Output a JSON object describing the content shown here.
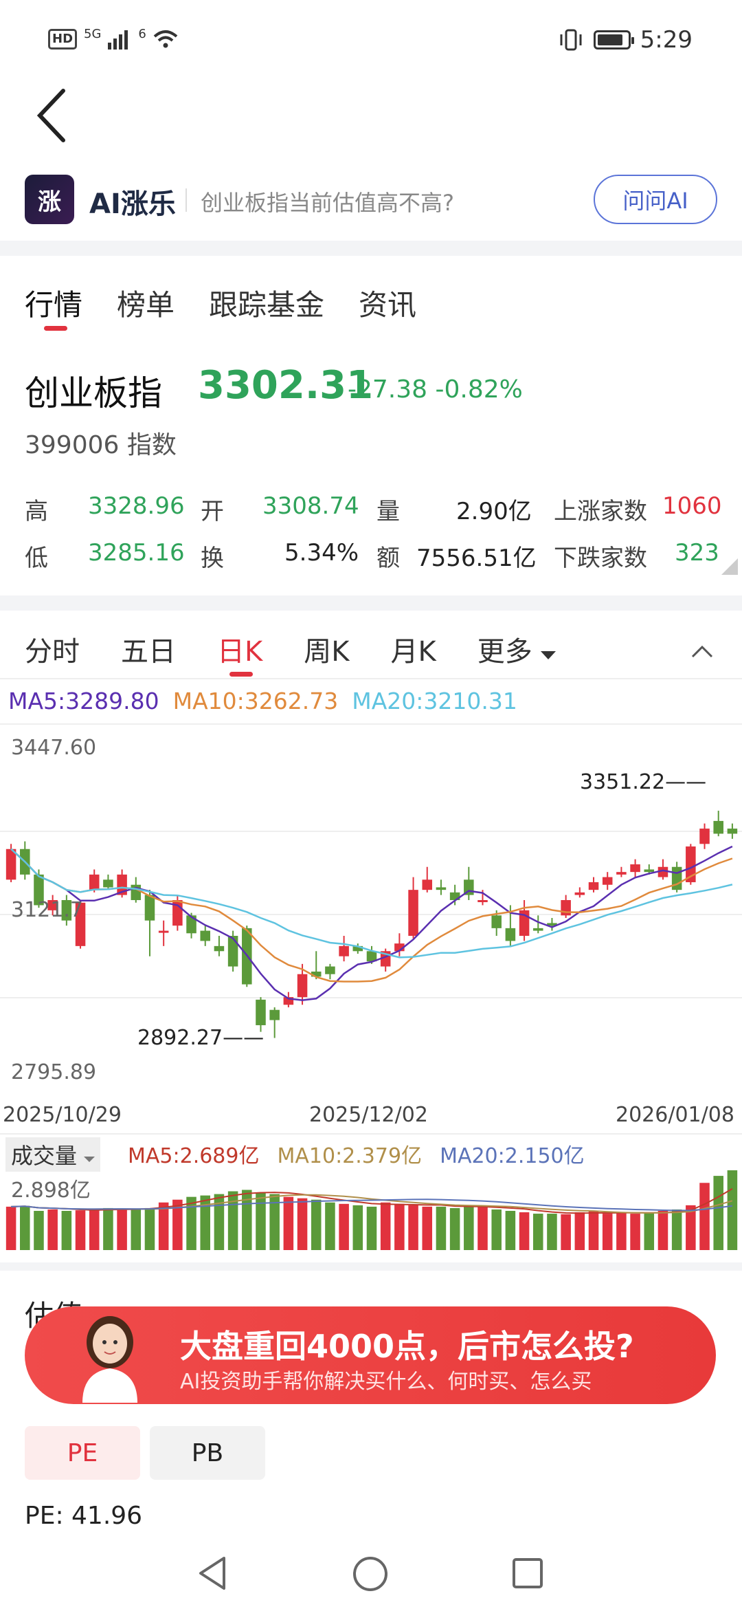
{
  "status_bar": {
    "hd": "HD",
    "signal": "5G",
    "wifi": "6",
    "time": "5:29"
  },
  "ai_bar": {
    "logo_text": "涨",
    "title": "AI涨乐",
    "question": "创业板指当前估值高不高?",
    "ask_button": "问问AI"
  },
  "top_tabs": [
    {
      "label": "行情"
    },
    {
      "label": "榜单"
    },
    {
      "label": "跟踪基金"
    },
    {
      "label": "资讯"
    }
  ],
  "quote": {
    "name": "创业板指",
    "price": "3302.31",
    "change": "-27.38",
    "change_pct": "-0.82%",
    "code_line": "399006 指数",
    "high_label": "高",
    "high": "3328.96",
    "open_label": "开",
    "open": "3308.74",
    "vol_label": "量",
    "vol": "2.90亿",
    "up_label": "上涨家数",
    "up": "1060",
    "low_label": "低",
    "low": "3285.16",
    "turn_label": "换",
    "turn": "5.34%",
    "amt_label": "额",
    "amt": "7556.51亿",
    "down_label": "下跌家数",
    "down": "323"
  },
  "chart_tabs": [
    {
      "label": "分时"
    },
    {
      "label": "五日"
    },
    {
      "label": "日K"
    },
    {
      "label": "周K"
    },
    {
      "label": "月K"
    },
    {
      "label": "更多"
    }
  ],
  "ma": {
    "ma5": "MA5:3289.80",
    "ma10": "MA10:3262.73",
    "ma20": "MA20:3210.31"
  },
  "axis": {
    "top": "3447.60",
    "mid": "3121.7",
    "bottom": "2795.89",
    "date_start": "2025/10/29",
    "date_mid": "2025/12/02",
    "date_end": "2026/01/08",
    "high_mark": "3351.22",
    "low_mark": "2892.27"
  },
  "volume": {
    "label": "成交量",
    "ma5": "MA5:2.689亿",
    "ma10": "MA10:2.379亿",
    "ma20": "MA20:2.150亿",
    "top": "2.898亿"
  },
  "banner": {
    "title": "大盘重回4000点，后市怎么投?",
    "subtitle": "AI投资助手帮你解决买什么、何时买、怎么买"
  },
  "valuation": {
    "section_title": "估值",
    "pe_tab": "PE",
    "pb_tab": "PB",
    "pe_value": "PE: 41.96"
  },
  "colors": {
    "up": "#e1323e",
    "down": "#5b9a3a",
    "ma5": "#5a2fb0",
    "ma10": "#e08a3c",
    "ma20": "#5ec3e0",
    "accent": "#e1323e"
  },
  "chart_data": {
    "type": "candlestick",
    "ylim": [
      2795.89,
      3447.6
    ],
    "candles": [
      {
        "o": 3190,
        "c": 3250,
        "h": 3260,
        "l": 3185
      },
      {
        "o": 3250,
        "c": 3200,
        "h": 3265,
        "l": 3190
      },
      {
        "o": 3200,
        "c": 3140,
        "h": 3210,
        "l": 3135
      },
      {
        "o": 3130,
        "c": 3150,
        "h": 3160,
        "l": 3120
      },
      {
        "o": 3150,
        "c": 3110,
        "h": 3160,
        "l": 3100
      },
      {
        "o": 3060,
        "c": 3145,
        "h": 3150,
        "l": 3055
      },
      {
        "o": 3170,
        "c": 3200,
        "h": 3210,
        "l": 3165
      },
      {
        "o": 3190,
        "c": 3175,
        "h": 3200,
        "l": 3170
      },
      {
        "o": 3160,
        "c": 3200,
        "h": 3210,
        "l": 3155
      },
      {
        "o": 3180,
        "c": 3150,
        "h": 3195,
        "l": 3145
      },
      {
        "o": 3160,
        "c": 3110,
        "h": 3170,
        "l": 3040
      },
      {
        "o": 3090,
        "c": 3090,
        "h": 3110,
        "l": 3060
      },
      {
        "o": 3100,
        "c": 3150,
        "h": 3160,
        "l": 3090
      },
      {
        "o": 3120,
        "c": 3085,
        "h": 3125,
        "l": 3075
      },
      {
        "o": 3090,
        "c": 3070,
        "h": 3100,
        "l": 3060
      },
      {
        "o": 3060,
        "c": 3050,
        "h": 3080,
        "l": 3040
      },
      {
        "o": 3080,
        "c": 3020,
        "h": 3090,
        "l": 3010
      },
      {
        "o": 3095,
        "c": 2985,
        "h": 3100,
        "l": 2980
      },
      {
        "o": 2955,
        "c": 2905,
        "h": 2960,
        "l": 2892
      },
      {
        "o": 2935,
        "c": 2915,
        "h": 2940,
        "l": 2880
      },
      {
        "o": 2945,
        "c": 2960,
        "h": 2970,
        "l": 2940
      },
      {
        "o": 2960,
        "c": 3005,
        "h": 3025,
        "l": 2945
      },
      {
        "o": 3010,
        "c": 3000,
        "h": 3050,
        "l": 2995
      },
      {
        "o": 3020,
        "c": 3005,
        "h": 3025,
        "l": 2995
      },
      {
        "o": 3040,
        "c": 3060,
        "h": 3080,
        "l": 3030
      },
      {
        "o": 3060,
        "c": 3050,
        "h": 3065,
        "l": 3045
      },
      {
        "o": 3050,
        "c": 3030,
        "h": 3060,
        "l": 3025
      },
      {
        "o": 3020,
        "c": 3050,
        "h": 3055,
        "l": 3010
      },
      {
        "o": 3050,
        "c": 3065,
        "h": 3085,
        "l": 3040
      },
      {
        "o": 3080,
        "c": 3170,
        "h": 3195,
        "l": 3075
      },
      {
        "o": 3170,
        "c": 3190,
        "h": 3215,
        "l": 3165
      },
      {
        "o": 3175,
        "c": 3170,
        "h": 3190,
        "l": 3160
      },
      {
        "o": 3165,
        "c": 3150,
        "h": 3180,
        "l": 3140
      },
      {
        "o": 3190,
        "c": 3160,
        "h": 3215,
        "l": 3150
      },
      {
        "o": 3150,
        "c": 3150,
        "h": 3170,
        "l": 3140
      },
      {
        "o": 3120,
        "c": 3095,
        "h": 3130,
        "l": 3080
      },
      {
        "o": 3095,
        "c": 3070,
        "h": 3140,
        "l": 3060
      },
      {
        "o": 3080,
        "c": 3130,
        "h": 3150,
        "l": 3070
      },
      {
        "o": 3095,
        "c": 3090,
        "h": 3120,
        "l": 3085
      },
      {
        "o": 3105,
        "c": 3100,
        "h": 3115,
        "l": 3090
      },
      {
        "o": 3120,
        "c": 3150,
        "h": 3160,
        "l": 3115
      },
      {
        "o": 3160,
        "c": 3165,
        "h": 3175,
        "l": 3155
      },
      {
        "o": 3170,
        "c": 3185,
        "h": 3195,
        "l": 3165
      },
      {
        "o": 3180,
        "c": 3195,
        "h": 3205,
        "l": 3170
      },
      {
        "o": 3200,
        "c": 3205,
        "h": 3215,
        "l": 3195
      },
      {
        "o": 3205,
        "c": 3220,
        "h": 3230,
        "l": 3195
      },
      {
        "o": 3210,
        "c": 3205,
        "h": 3220,
        "l": 3200
      },
      {
        "o": 3195,
        "c": 3215,
        "h": 3230,
        "l": 3190
      },
      {
        "o": 3215,
        "c": 3170,
        "h": 3225,
        "l": 3165
      },
      {
        "o": 3185,
        "c": 3255,
        "h": 3260,
        "l": 3180
      },
      {
        "o": 3260,
        "c": 3290,
        "h": 3300,
        "l": 3250
      },
      {
        "o": 3305,
        "c": 3280,
        "h": 3325,
        "l": 3275
      },
      {
        "o": 3290,
        "c": 3280,
        "h": 3300,
        "l": 3270
      }
    ],
    "volume": [
      1.55,
      1.58,
      1.4,
      1.45,
      1.4,
      1.42,
      1.45,
      1.5,
      1.48,
      1.45,
      1.5,
      1.7,
      1.8,
      1.9,
      1.95,
      2.0,
      2.1,
      2.15,
      2.05,
      2.0,
      1.9,
      1.85,
      1.8,
      1.7,
      1.65,
      1.6,
      1.55,
      1.7,
      1.65,
      1.6,
      1.55,
      1.55,
      1.5,
      1.6,
      1.55,
      1.45,
      1.4,
      1.35,
      1.3,
      1.3,
      1.28,
      1.35,
      1.4,
      1.3,
      1.32,
      1.3,
      1.35,
      1.4,
      1.45,
      1.6,
      2.4,
      2.65,
      2.85
    ]
  }
}
